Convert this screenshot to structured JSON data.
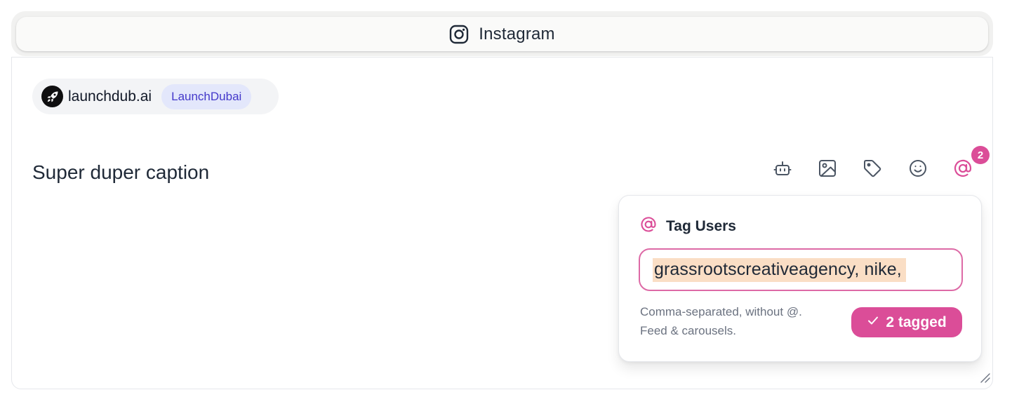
{
  "platform_tabs": {
    "active": {
      "icon": "instagram-icon",
      "label": "Instagram"
    }
  },
  "account": {
    "avatar_icon": "rocket-icon",
    "handle": "launchdub.ai",
    "brand_tag": "LaunchDubai"
  },
  "editor": {
    "caption": "Super duper caption"
  },
  "toolbar": {
    "buttons": [
      {
        "icon": "robot-icon"
      },
      {
        "icon": "image-icon"
      },
      {
        "icon": "tag-icon"
      },
      {
        "icon": "smiley-icon"
      },
      {
        "icon": "at-sign-icon",
        "badge": "2",
        "active": true
      }
    ]
  },
  "tag_users": {
    "header_icon": "at-sign-icon",
    "title": "Tag Users",
    "input_value": "grassrootscreativeagency, nike,",
    "hint_line1": "Comma-separated, without @.",
    "hint_line2": "Feed & carousels.",
    "tagged_label": "2 tagged",
    "tagged_icon": "check-icon"
  },
  "colors": {
    "accent_pink": "#db4d98",
    "input_border": "#dd6aa6",
    "selection_highlight": "#fadec5",
    "brand_chip_bg": "#e3e7fb",
    "brand_chip_text": "#4338ca"
  }
}
